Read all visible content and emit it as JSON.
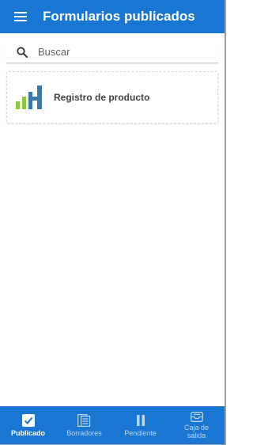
{
  "appbar": {
    "title": "Formularios publicados",
    "menu_icon": "hamburger-menu-icon"
  },
  "search": {
    "placeholder": "Buscar",
    "value": "",
    "icon": "search-icon"
  },
  "forms": [
    {
      "title": "Registro de producto",
      "icon": "bar-chart-logo-icon"
    }
  ],
  "bottom_nav": {
    "active_index": 0,
    "items": [
      {
        "label": "Publicado",
        "icon": "checkbox-icon"
      },
      {
        "label": "Borradores",
        "icon": "drafts-icon"
      },
      {
        "label": "Pendiente",
        "icon": "pause-icon"
      },
      {
        "label": "Caja de salida",
        "icon": "outbox-icon"
      }
    ]
  },
  "colors": {
    "primary": "#1976d2",
    "logo_green": "#8dc63f",
    "logo_blue": "#3a78a8",
    "nav_inactive": "#bfd6f2",
    "text_dark": "#424242"
  }
}
